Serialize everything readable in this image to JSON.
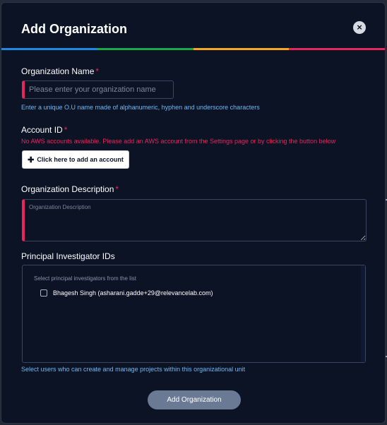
{
  "modal": {
    "title": "Add Organization",
    "close_glyph": "×"
  },
  "color_bar": [
    "#1e88e5",
    "#18a84a",
    "#f5a623",
    "#e8265b"
  ],
  "org_name": {
    "label": "Organization Name",
    "required_mark": "*",
    "placeholder": "Please enter your organization name",
    "value": "",
    "hint": "Enter a unique O.U name made of alphanumeric, hyphen and underscore characters"
  },
  "account_id": {
    "label": "Account ID",
    "required_mark": "*",
    "error": "No AWS accounts available. Please add an AWS account from the Settings page or by clicking the button below",
    "add_button_label": "Click here to add an account",
    "add_button_icon": "plus-icon",
    "add_button_glyph": "✚"
  },
  "org_description": {
    "label": "Organization Description",
    "required_mark": "*",
    "placeholder": "Organization Description",
    "value": ""
  },
  "principal_investigators": {
    "label": "Principal Investigator IDs",
    "placeholder": "Select principal investigators from the list",
    "options": [
      {
        "label": "Bhagesh Singh (asharani.gadde+29@relevancelab.com)",
        "checked": false
      }
    ],
    "hint": "Select users who can create and manage projects within this organizational unit"
  },
  "submit": {
    "label": "Add Organization"
  }
}
